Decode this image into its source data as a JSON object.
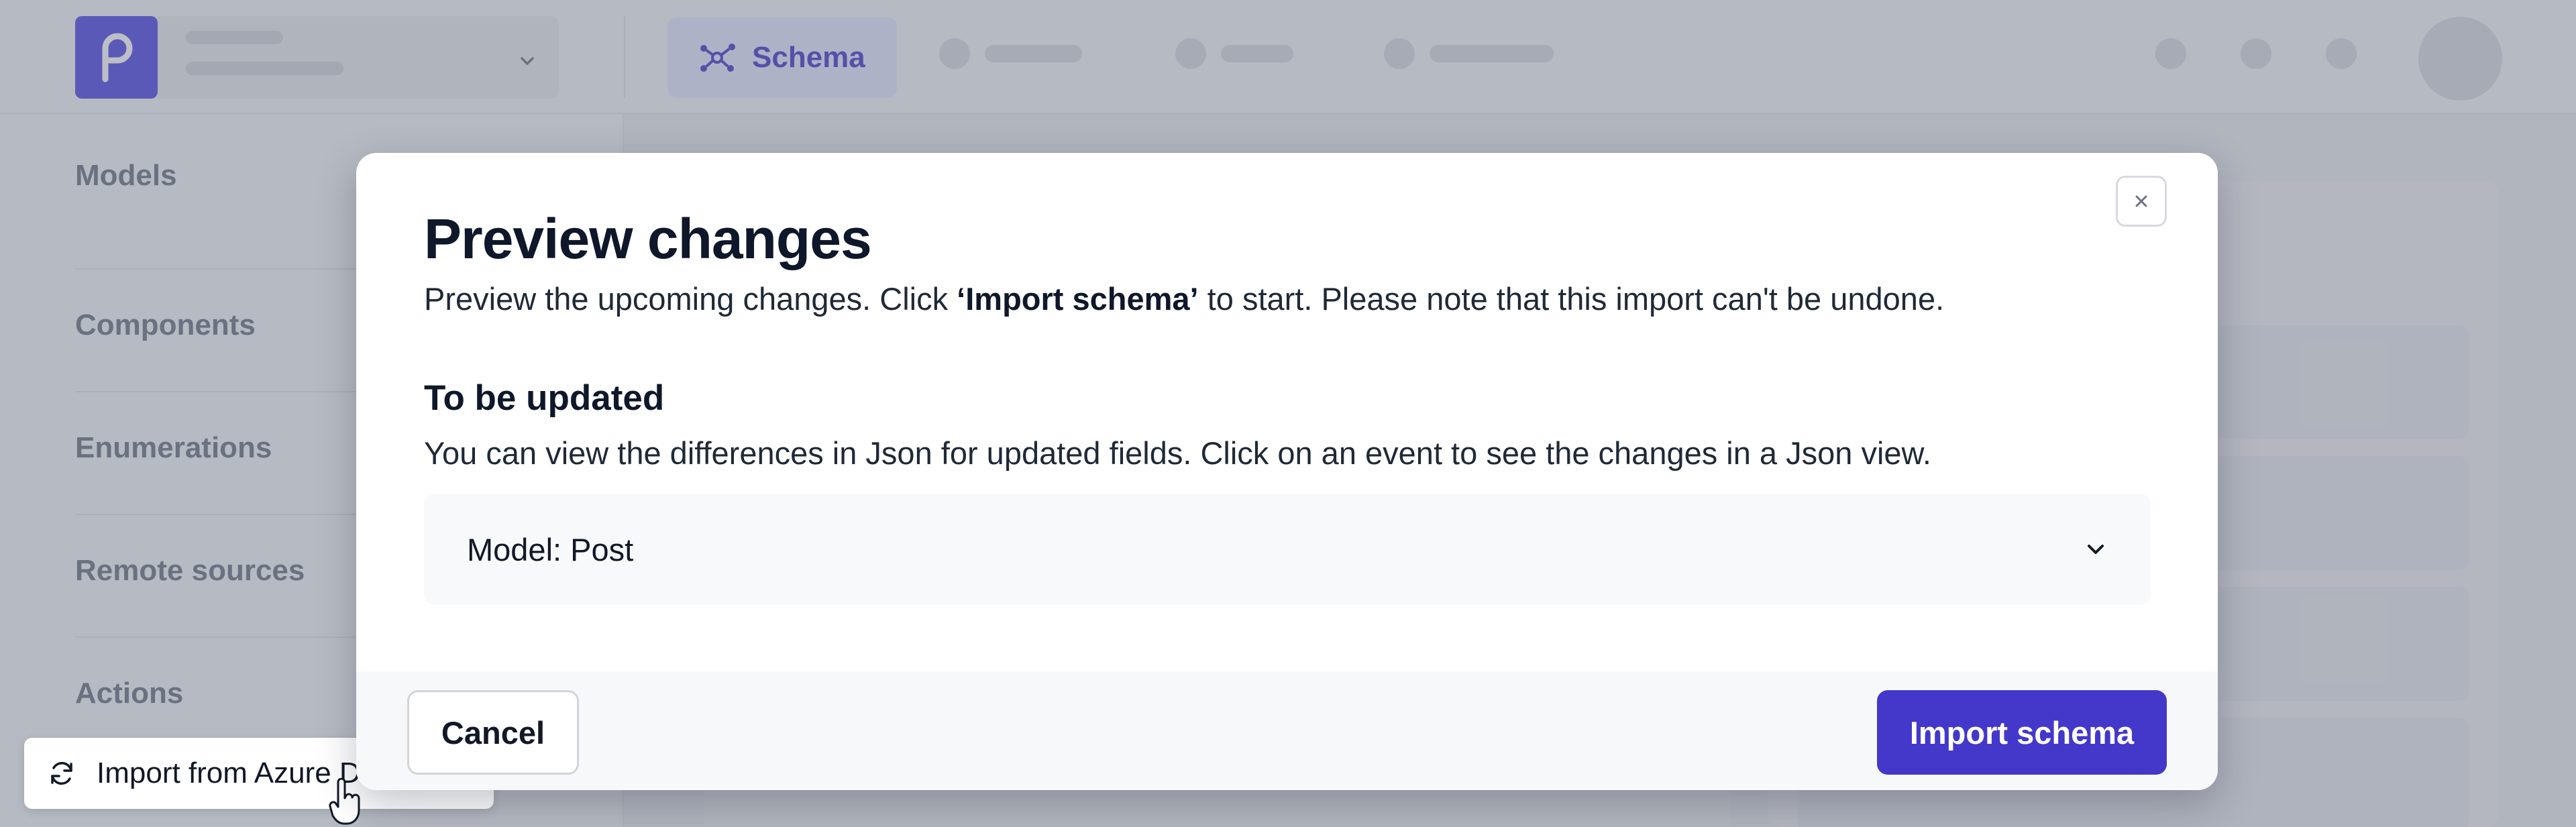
{
  "app": {
    "logo_letter": "p",
    "brand_color": "#4f46e5",
    "active_tab_label": "Schema"
  },
  "sidebar": {
    "items": [
      {
        "label": "Models"
      },
      {
        "label": "Components"
      },
      {
        "label": "Enumerations"
      },
      {
        "label": "Remote sources"
      },
      {
        "label": "Actions"
      }
    ],
    "import_action_label": "Import from Azure D"
  },
  "modal": {
    "title": "Preview changes",
    "description_before": "Preview the upcoming changes. Click ",
    "description_bold": "‘Import schema’",
    "description_after": " to start. Please note that this import can't be undone.",
    "section_title": "To be updated",
    "section_description": "You can view the differences in Json for updated fields. Click on an event to see the changes in a Json view.",
    "accordion_label": "Model: Post",
    "cancel_label": "Cancel",
    "import_label": "Import schema",
    "close_icon": "close-icon"
  },
  "colors": {
    "primary_button": "#4338ca",
    "overlay": "rgba(107,114,128,0.45)"
  }
}
